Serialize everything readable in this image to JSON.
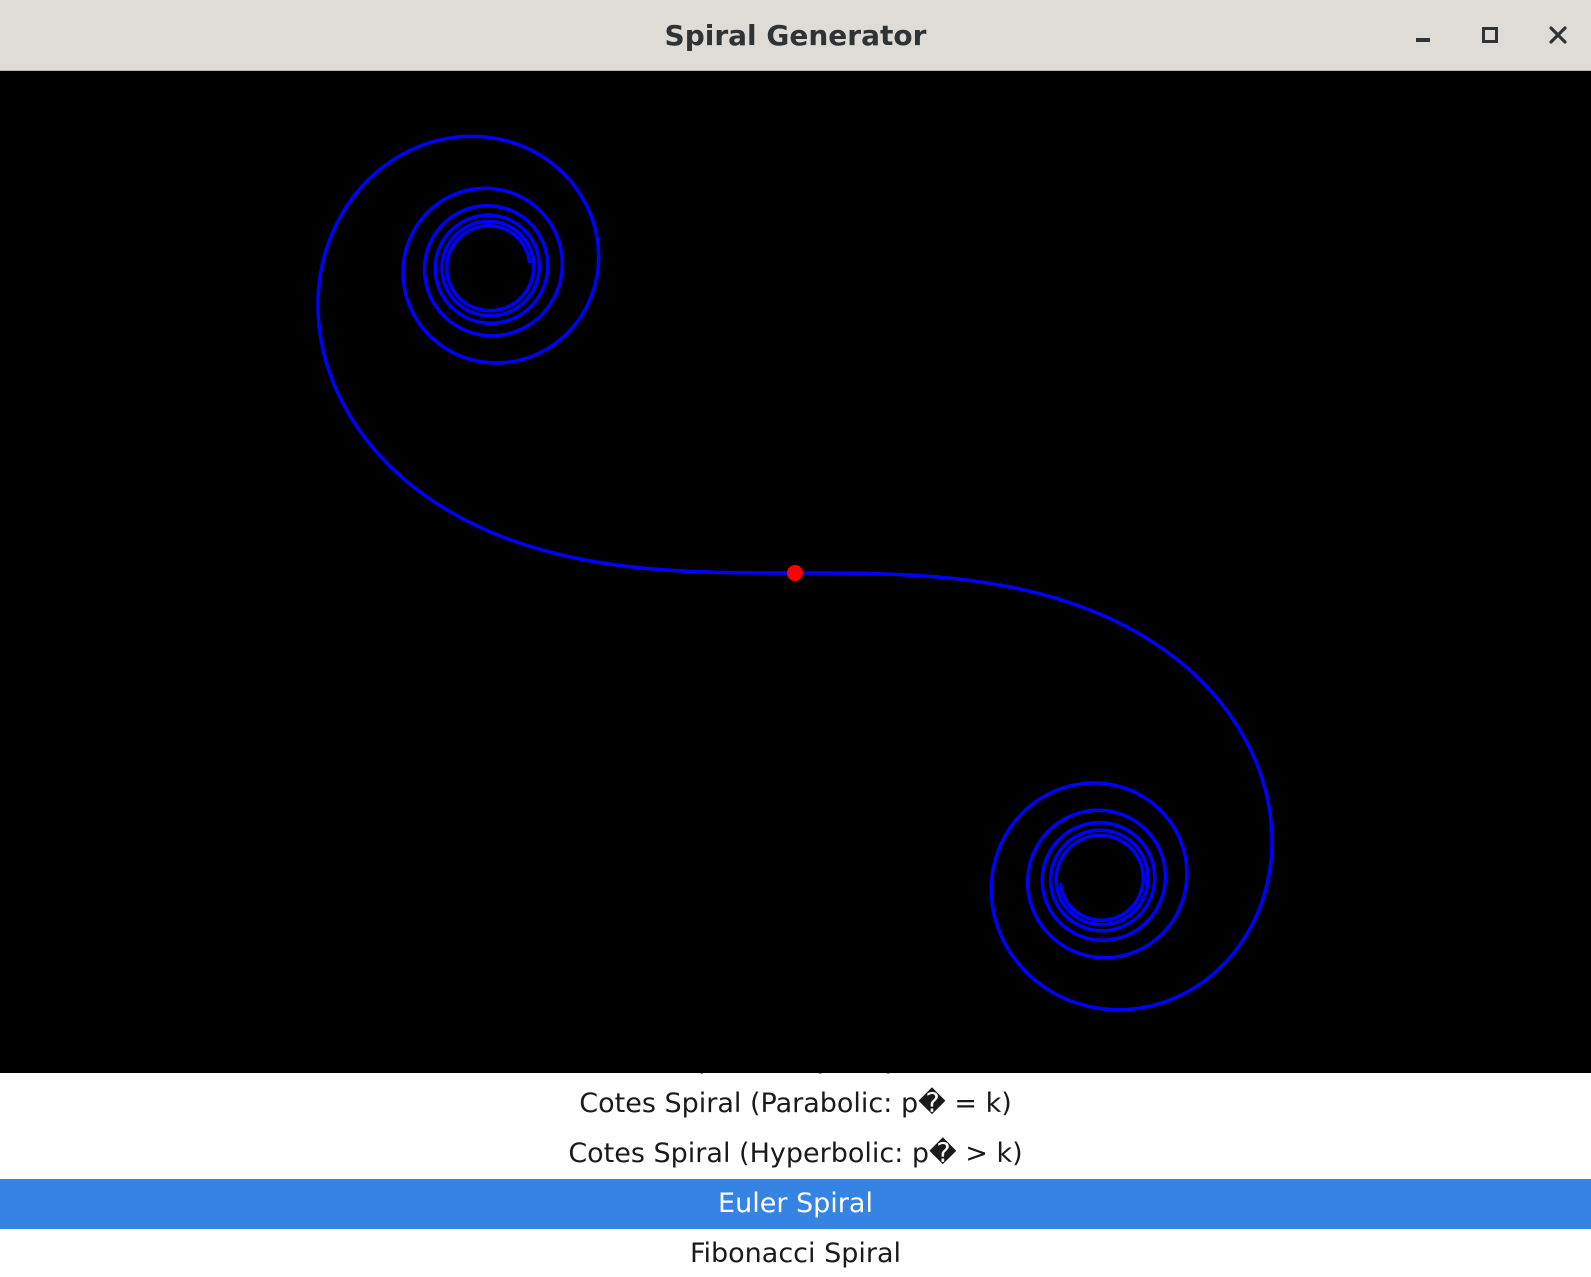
{
  "window": {
    "title": "Spiral Generator",
    "controls": [
      "minimize-icon",
      "maximize-icon",
      "close-icon"
    ]
  },
  "canvas": {
    "background": "#000000",
    "curve_name": "Euler Spiral",
    "curve_color": "#0000ff",
    "origin_marker_color": "#ff0000"
  },
  "spiral_list": {
    "partial_item": "Cotes Spiral (Elliptic: p� < k)",
    "items": [
      "Cotes Spiral (Parabolic: p� = k)",
      "Cotes Spiral (Hyperbolic: p� > k)",
      "Euler Spiral",
      "Fibonacci Spiral"
    ],
    "selected": "Euler Spiral",
    "selection_color": "#3584e4"
  }
}
